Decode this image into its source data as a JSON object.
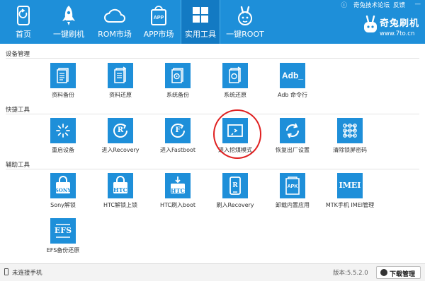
{
  "topbar": {
    "forum": "奇兔技术论坛",
    "feedback": "反馈"
  },
  "brand": {
    "name": "奇兔刷机",
    "url": "www.7to.cn"
  },
  "nav": [
    {
      "label": "首页",
      "icon": "phone-icon"
    },
    {
      "label": "一键刷机",
      "icon": "rocket-icon"
    },
    {
      "label": "ROM市场",
      "icon": "cloud-icon"
    },
    {
      "label": "APP市场",
      "icon": "app-bag-icon"
    },
    {
      "label": "实用工具",
      "icon": "grid-icon",
      "active": true
    },
    {
      "label": "一键ROOT",
      "icon": "rabbit-icon"
    }
  ],
  "sections": [
    {
      "title": "设备管理",
      "items": [
        {
          "label": "资料备份",
          "icon": "document-icon"
        },
        {
          "label": "资料还原",
          "icon": "document-restore-icon"
        },
        {
          "label": "系统备份",
          "icon": "system-backup-icon"
        },
        {
          "label": "系统还原",
          "icon": "system-restore-icon"
        },
        {
          "label": "Adb 命令行",
          "icon": "adb-icon",
          "box_text": "Adb_"
        }
      ]
    },
    {
      "title": "快捷工具",
      "items": [
        {
          "label": "重启设备",
          "icon": "restart-icon"
        },
        {
          "label": "进入Recovery",
          "icon": "recovery-icon",
          "box_text": "R"
        },
        {
          "label": "进入Fastboot",
          "icon": "fastboot-icon",
          "box_text": "F"
        },
        {
          "label": "进入挖煤模式",
          "icon": "download-mode-icon"
        },
        {
          "label": "恢复出厂设置",
          "icon": "factory-reset-icon"
        },
        {
          "label": "清除锁屏密码",
          "icon": "pattern-lock-icon"
        }
      ]
    },
    {
      "title": "辅助工具",
      "items": [
        {
          "label": "Sony解锁",
          "icon": "sony-lock-icon",
          "box_text": "SONY"
        },
        {
          "label": "HTC解锁上锁",
          "icon": "htc-lock-icon",
          "box_text": "HTC"
        },
        {
          "label": "HTC刷入boot",
          "icon": "htc-boot-icon",
          "box_text": "HTC"
        },
        {
          "label": "刷入Recovery",
          "icon": "flash-recovery-icon",
          "box_text": "R"
        },
        {
          "label": "卸载内置应用",
          "icon": "apk-icon",
          "box_text": "APK"
        },
        {
          "label": "MTK手机 IMEI管理",
          "icon": "imei-icon",
          "box_text": "IMEI"
        },
        {
          "label": "EFS备份还原",
          "icon": "efs-icon",
          "box_text": "EFS"
        }
      ]
    }
  ],
  "status": {
    "connection": "未连接手机",
    "version": "版本:5.5.2.0",
    "download_manager": "下载管理"
  },
  "colors": {
    "brand_blue": "#1e8fd9",
    "active_tab": "#137ac3",
    "highlight_red": "#e02020"
  }
}
